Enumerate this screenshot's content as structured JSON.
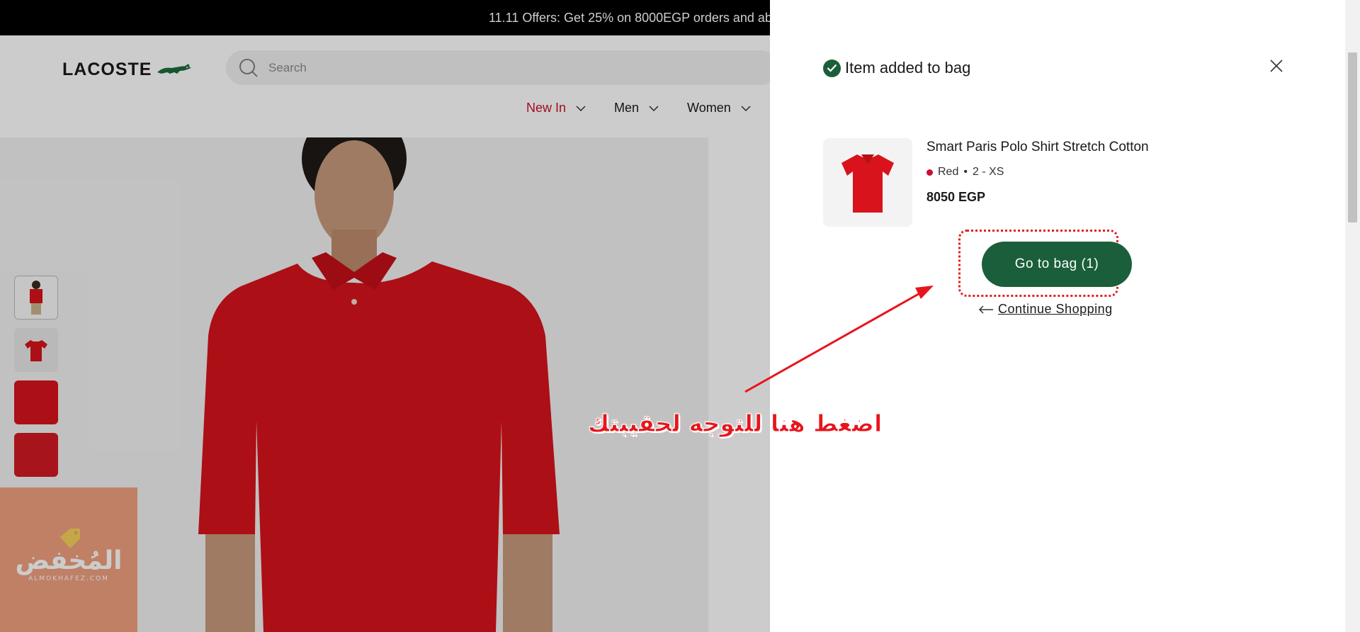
{
  "promo": {
    "text": "11.11 Offers: Get 25% on 8000EGP orders and abo"
  },
  "header": {
    "logo_text": "LACOSTE",
    "search_placeholder": "Search",
    "nav": [
      {
        "label": "New In",
        "active": true
      },
      {
        "label": "Men",
        "active": false
      },
      {
        "label": "Women",
        "active": false
      }
    ]
  },
  "watermark": {
    "title": "المُخفض",
    "subtitle": "ALMOKHAFEZ.COM"
  },
  "drawer": {
    "title": "Item added to bag",
    "product": {
      "name": "Smart Paris Polo Shirt Stretch Cotton",
      "color": "Red",
      "separator": "•",
      "size": "2 - XS",
      "price": "8050 EGP"
    },
    "go_to_bag_label": "Go to bag (1)",
    "continue_label": "Continue Shopping"
  },
  "annotation": {
    "text": "اضغط هنا للتوجه لحقيبتك"
  },
  "colors": {
    "brand_green": "#1b5e3b",
    "accent_red": "#c8102e",
    "annotation_red": "#e8141c"
  }
}
